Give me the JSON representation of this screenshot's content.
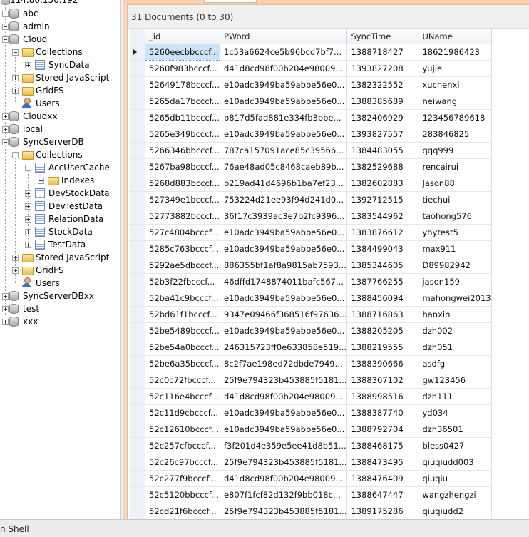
{
  "tree": {
    "server_label": "114.80.156.192",
    "items": [
      {
        "label": "abc",
        "type": "db"
      },
      {
        "label": "admin",
        "type": "db"
      },
      {
        "label": "Cloud",
        "type": "db"
      },
      {
        "label": "Collections",
        "type": "folder"
      },
      {
        "label": "SyncData",
        "type": "collection"
      },
      {
        "label": "Stored JavaScript",
        "type": "folder"
      },
      {
        "label": "GridFS",
        "type": "folder"
      },
      {
        "label": "Users",
        "type": "user"
      },
      {
        "label": "Cloudxx",
        "type": "db"
      },
      {
        "label": "local",
        "type": "db"
      },
      {
        "label": "SyncServerDB",
        "type": "db"
      },
      {
        "label": "Collections",
        "type": "folder"
      },
      {
        "label": "AccUserCache",
        "type": "collection"
      },
      {
        "label": "Indexes",
        "type": "folder"
      },
      {
        "label": "DevStockData",
        "type": "collection"
      },
      {
        "label": "DevTestData",
        "type": "collection"
      },
      {
        "label": "RelationData",
        "type": "collection"
      },
      {
        "label": "StockData",
        "type": "collection"
      },
      {
        "label": "TestData",
        "type": "collection"
      },
      {
        "label": "Stored JavaScript",
        "type": "folder"
      },
      {
        "label": "GridFS",
        "type": "folder"
      },
      {
        "label": "Users",
        "type": "user"
      },
      {
        "label": "SyncServerDBxx",
        "type": "db"
      },
      {
        "label": "test",
        "type": "db"
      },
      {
        "label": "xxx",
        "type": "db"
      }
    ]
  },
  "documents": {
    "header": "31 Documents (0 to 30)",
    "columns": [
      "_id",
      "PWord",
      "SyncTime",
      "UName"
    ],
    "rows": [
      [
        "5260eecbbcccf...",
        "1c53a6624ce5b96bcd7bf7...",
        "1388718427",
        "18621986423"
      ],
      [
        "5260f983bcccf...",
        "d41d8cd98f00b204e98009...",
        "1393827208",
        "yujie"
      ],
      [
        "52649178bcccf...",
        "e10adc3949ba59abbe56e0...",
        "1382322552",
        "xuchenxi"
      ],
      [
        "5265da17bcccf...",
        "e10adc3949ba59abbe56e0...",
        "1388385689",
        "neiwang"
      ],
      [
        "5265db11bcccf...",
        "b817d5fad881e334fb3bbe...",
        "1382406929",
        "123456789618"
      ],
      [
        "5265e349bcccf...",
        "e10adc3949ba59abbe56e0...",
        "1393827557",
        "283846825"
      ],
      [
        "5266346bbcccf...",
        "787ca157091ace85c39566...",
        "1384483055",
        "qqq999"
      ],
      [
        "5267ba98bcccf...",
        "76ae48ad05c8468caeb89b...",
        "1382529688",
        "rencairui"
      ],
      [
        "5268d883bcccf...",
        "b219ad41d4696b1ba7ef23...",
        "1382602883",
        "Jason88"
      ],
      [
        "527349e1bcccf...",
        "753224d21ee93f94d241d0...",
        "1392712515",
        "tiechui"
      ],
      [
        "52773882bcccf...",
        "36f17c3939ac3e7b2fc9396...",
        "1383544962",
        "taohong576"
      ],
      [
        "527c4804bcccf...",
        "e10adc3949ba59abbe56e0...",
        "1383876612",
        "yhytest5"
      ],
      [
        "5285c763bcccf...",
        "e10adc3949ba59abbe56e0...",
        "1384499043",
        "max911"
      ],
      [
        "5292ae5dbcccf...",
        "886355bf1af8a9815ab7593...",
        "1385344605",
        "D89982942"
      ],
      [
        "52b3f22fbcccf...",
        "46dffd1748874011bafc567...",
        "1387766255",
        "jason159"
      ],
      [
        "52ba41c9bcccf...",
        "e10adc3949ba59abbe56e0...",
        "1388456094",
        "mahongwei2013"
      ],
      [
        "52bd61f1bcccf...",
        "9347e09466f368516f97636...",
        "1388716863",
        "hanxin"
      ],
      [
        "52be5489bcccf...",
        "e10adc3949ba59abbe56e0...",
        "1388205205",
        "dzh002"
      ],
      [
        "52be54a0bcccf...",
        "246315723ff0e633858e519...",
        "1388219555",
        "dzh051"
      ],
      [
        "52be6a35bcccf...",
        "8c2f7ae198ed72dbde7949...",
        "1388390666",
        "asdfg"
      ],
      [
        "52c0c72fbcccf...",
        "25f9e794323b453885f5181...",
        "1388367102",
        "gw123456"
      ],
      [
        "52c116e4bcccf...",
        "d41d8cd98f00b204e98009...",
        "1388998516",
        "dzh111"
      ],
      [
        "52c11d9cbcccf...",
        "e10adc3949ba59abbe56e0...",
        "1388387740",
        "yd034"
      ],
      [
        "52c12610bcccf...",
        "e10adc3949ba59abbe56e0...",
        "1388792704",
        "dzh36501"
      ],
      [
        "52c257cfbcccf...",
        "f3f201d4e359e5ee41d8b51...",
        "1388468175",
        "bless0427"
      ],
      [
        "52c26c97bcccf...",
        "25f9e794323b453885f5181...",
        "1388473495",
        "qiuqiudd003"
      ],
      [
        "52c277f9bcccf...",
        "d41d8cd98f00b204e98009...",
        "1388476409",
        "qiuqiu"
      ],
      [
        "52c5120bbcccf...",
        "e807f1fcf82d132f9bb018c...",
        "1388647447",
        "wangzhengzi"
      ],
      [
        "52cd21f6bcccf...",
        "25f9e794323b453885f5181...",
        "1389175286",
        "qiuqiudd2"
      ]
    ]
  },
  "statusbar": {
    "label": "n Shell"
  }
}
